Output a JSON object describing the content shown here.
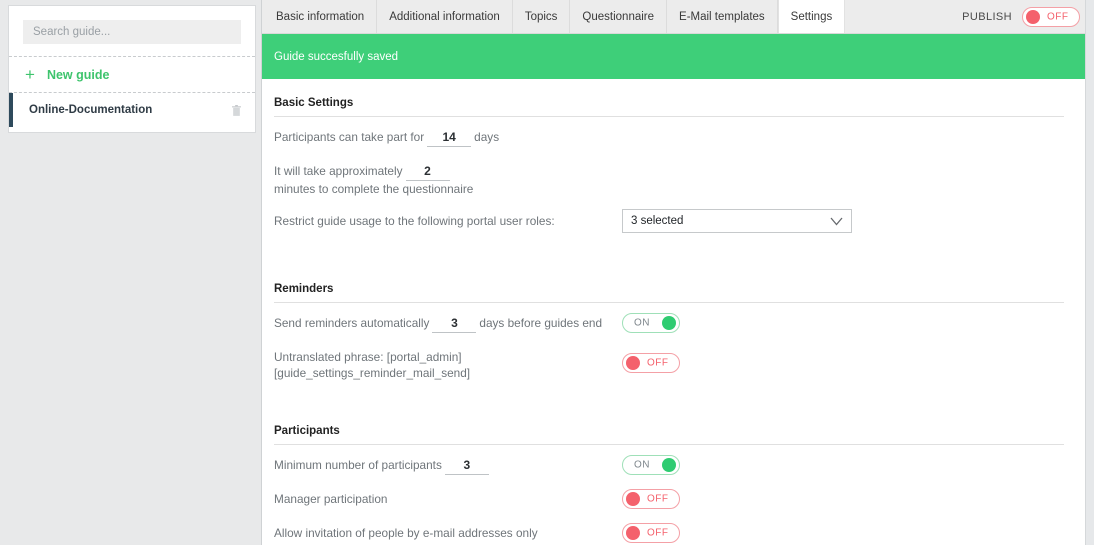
{
  "sidebar": {
    "search": {
      "placeholder": "Search guide...",
      "value": ""
    },
    "new_guide_label": "New guide",
    "plus_icon": "plus-icon",
    "guides": [
      {
        "label": "Online-Documentation",
        "delete_icon": "trash-icon",
        "selected": true
      }
    ]
  },
  "tabs": [
    {
      "label": "Basic information",
      "active": false
    },
    {
      "label": "Additional information",
      "active": false
    },
    {
      "label": "Topics",
      "active": false
    },
    {
      "label": "Questionnaire",
      "active": false
    },
    {
      "label": "E-Mail templates",
      "active": false
    },
    {
      "label": "Settings",
      "active": true
    }
  ],
  "publish": {
    "label": "PUBLISH",
    "state": "OFF"
  },
  "banner": {
    "message": "Guide succesfully saved"
  },
  "sections": {
    "basic": {
      "title": "Basic Settings",
      "participate_prefix": "Participants can take part for",
      "participate_days": "14",
      "participate_suffix": "days",
      "duration_prefix": "It will take approximately",
      "duration_minutes": "2",
      "duration_suffix": "minutes to complete the questionnaire",
      "roles_label": "Restrict guide usage to the following portal user roles:",
      "roles_value": "3 selected",
      "chevron_icon": "chevron-down-icon"
    },
    "reminders": {
      "title": "Reminders",
      "send_prefix": "Send reminders automatically",
      "send_days": "3",
      "send_suffix": "days before guides end",
      "send_state": "ON",
      "untranslated_label": "Untranslated phrase: [portal_admin] [guide_settings_reminder_mail_send]",
      "untranslated_state": "OFF"
    },
    "participants": {
      "title": "Participants",
      "minimum_label": "Minimum number of participants",
      "minimum_value": "3",
      "minimum_state": "ON",
      "manager_label": "Manager participation",
      "manager_state": "OFF",
      "email_only_label": "Allow invitation of people by e-mail addresses only",
      "email_only_state": "OFF"
    }
  },
  "colors": {
    "success_green": "#3ecf79",
    "toggle_on": "#2ecc71",
    "toggle_off": "#f4616c",
    "accent_bar": "#2e4a5c",
    "link_green": "#3ec46d"
  }
}
